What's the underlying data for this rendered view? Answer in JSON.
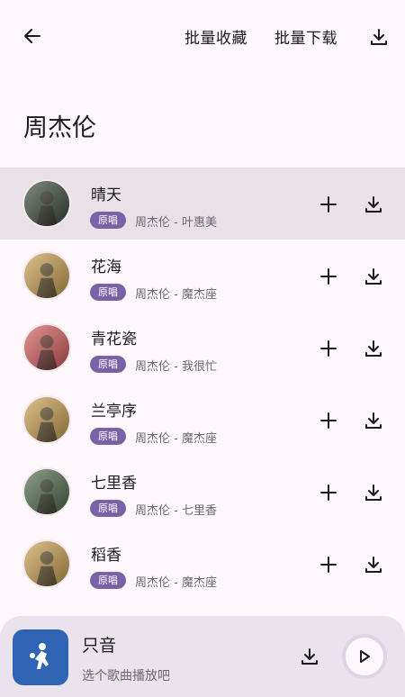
{
  "header": {
    "back_icon": "arrow-left-icon",
    "batch_favorite_label": "批量收藏",
    "batch_download_label": "批量下载",
    "download_icon": "download-icon"
  },
  "artist_title": "周杰伦",
  "songs": [
    {
      "title": "晴天",
      "badge": "原唱",
      "subtitle": "周杰伦 - 叶惠美",
      "cover_color": "#3a4a3a",
      "active": true
    },
    {
      "title": "花海",
      "badge": "原唱",
      "subtitle": "周杰伦 - 魔杰座",
      "cover_color": "#c9a050",
      "active": false
    },
    {
      "title": "青花瓷",
      "badge": "原唱",
      "subtitle": "周杰伦 - 我很忙",
      "cover_color": "#d45a5a",
      "active": false
    },
    {
      "title": "兰亭序",
      "badge": "原唱",
      "subtitle": "周杰伦 - 魔杰座",
      "cover_color": "#c9a050",
      "active": false
    },
    {
      "title": "七里香",
      "badge": "原唱",
      "subtitle": "周杰伦 - 七里香",
      "cover_color": "#4d6b4a",
      "active": false
    },
    {
      "title": "稻香",
      "badge": "原唱",
      "subtitle": "周杰伦 - 魔杰座",
      "cover_color": "#c9a050",
      "active": false
    }
  ],
  "player": {
    "title": "只音",
    "subtitle": "选个歌曲播放吧",
    "art_color": "#2f63b4",
    "download_icon": "download-icon",
    "play_icon": "play-icon"
  },
  "colors": {
    "background": "#fef7fb",
    "active_row": "#e8e2e8",
    "badge": "#7b62a8",
    "player_bar": "#eae2ec"
  }
}
